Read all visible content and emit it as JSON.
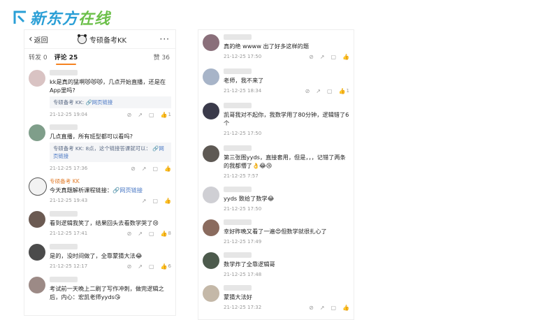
{
  "logo": {
    "text_main": "新东方",
    "text_accent": "在线"
  },
  "left_panel": {
    "back_label": "返回",
    "title": "专硕备考KK",
    "more": "···",
    "tabs": {
      "repost": "转发 0",
      "comments": "评论 25",
      "likes": "赞 36"
    },
    "comments": [
      {
        "text": "kk是真的猛啊😻😻😻，几点开始直播，还是在App里吗?",
        "reply_author": "专硕备考 KK:",
        "reply_link": "🔗网页链接",
        "date": "21-12-25 19:04",
        "likes": "1"
      },
      {
        "text": "几点直播，所有班型都可以看吗?",
        "reply_author": "专硕备考 KK: 8点，这个链接答课就可以：",
        "reply_link": "🔗网页链接",
        "date": "21-12-25 17:36",
        "likes": ""
      },
      {
        "author": "专硕备考 KK",
        "text": "今天真题解析课程链接：",
        "link": "🔗网页链接",
        "date": "21-12-25 19:43",
        "likes": ""
      },
      {
        "text": "看到逻辑我笑了，结果回头去看数学哭了😢",
        "date": "21-12-25 17:41",
        "likes": "8"
      },
      {
        "text": "是的，没时间做了，全靠蒙猜大法😂",
        "date": "21-12-25 12:17",
        "likes": "6"
      },
      {
        "text": "考试前一天晚上二刷了写作冲刺，做完逻辑之后，内心：宏凯老师yyds😘",
        "date": "",
        "likes": ""
      }
    ]
  },
  "right_panel": {
    "comments": [
      {
        "text": "真的绝 wwww 出了好多这样的题",
        "date": "21-12-25 17:50",
        "likes": ""
      },
      {
        "text": "老师，我不来了",
        "date": "21-12-25 18:34",
        "likes": "1"
      },
      {
        "text": "凯哥我对不起你，我数学用了80分钟，逻辑错了6个",
        "date": "21-12-25 17:50",
        "likes": ""
      },
      {
        "text": "第三张图yyds，直接套用，但是，，，记错了两条的我都懵了👌😂😢",
        "date": "21-12-25 7:57",
        "likes": ""
      },
      {
        "text": "yyds 致给了数学😂",
        "date": "21-12-25 17:50",
        "likes": ""
      },
      {
        "text": "幸好昨晚又看了一遍😍但数学就很扎心了",
        "date": "21-12-25 17:49",
        "likes": ""
      },
      {
        "text": "数学炸了全靠逻辑哥",
        "date": "21-12-25 17:48",
        "likes": ""
      },
      {
        "text": "蒙猜大法好",
        "date": "21-12-25 17:32",
        "likes": ""
      }
    ]
  },
  "icons": {
    "report": "⊘",
    "share": "↗",
    "comment": "▢",
    "like": "👍"
  }
}
